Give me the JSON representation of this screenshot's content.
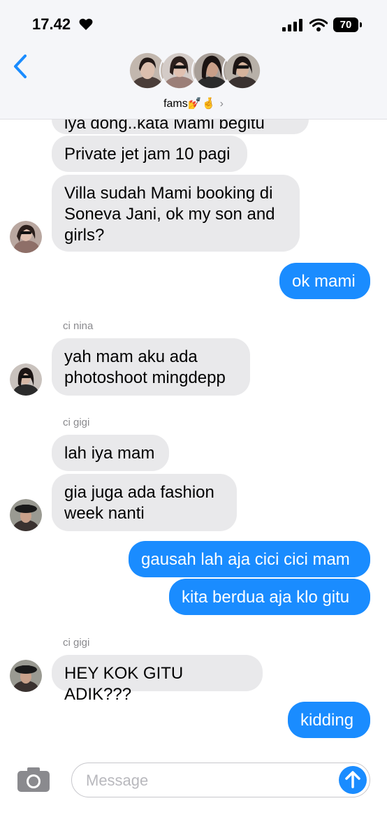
{
  "status": {
    "time": "17.42",
    "battery": "70"
  },
  "header": {
    "group_name": "fams💅🤞",
    "chevron": "›"
  },
  "messages": {
    "m0": "iya dong..kata Mami begitu",
    "m1": "Private jet jam 10 pagi",
    "m2": "Villa sudah Mami booking di Soneva Jani, ok my son and girls?",
    "m3": "ok mami",
    "s1": "ci nina",
    "m4": "yah mam aku ada photoshoot mingdepp",
    "s2": "ci gigi",
    "m5": "lah iya mam",
    "m6": "gia juga ada fashion week nanti",
    "m7": "gausah lah aja cici cici mam",
    "m8": "kita berdua aja klo gitu",
    "s3": "ci gigi",
    "m9": "HEY KOK GITU ADIK???",
    "m10": "kidding"
  },
  "input": {
    "placeholder": "Message"
  },
  "colors": {
    "outgoing": "#1a8cff",
    "incoming": "#e9e9eb",
    "accent": "#1a8cff"
  }
}
